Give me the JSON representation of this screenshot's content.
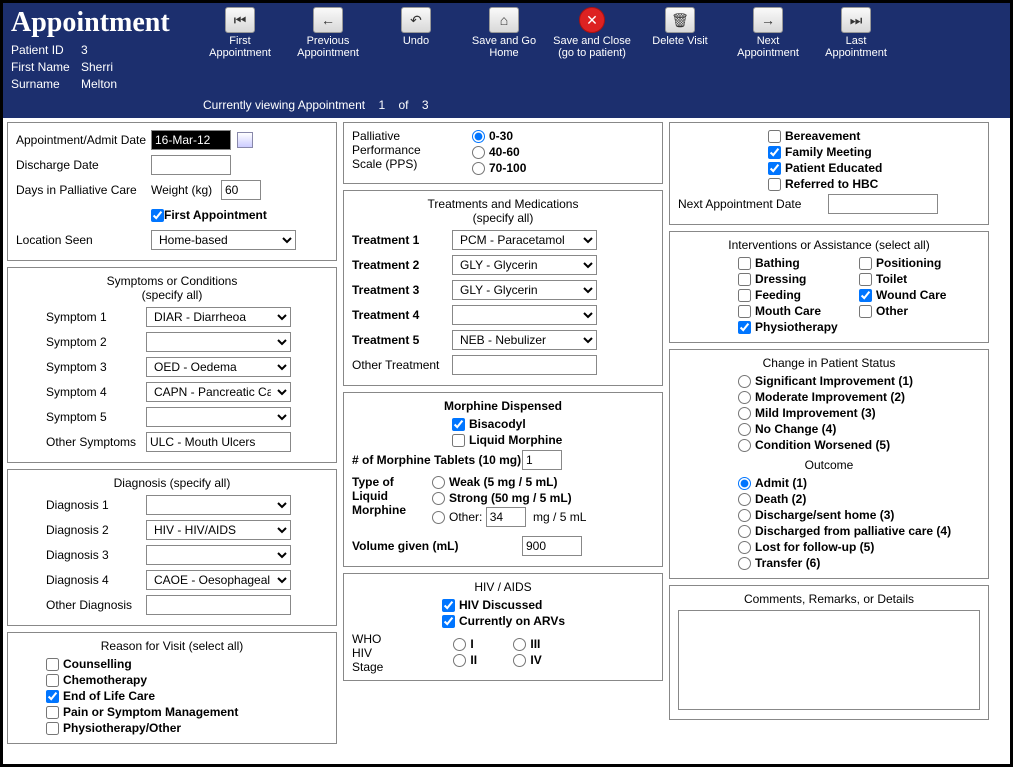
{
  "header": {
    "title": "Appointment",
    "patient_id_label": "Patient ID",
    "patient_id": "3",
    "first_name_label": "First Name",
    "first_name": "Sherri",
    "surname_label": "Surname",
    "surname": "Melton"
  },
  "toolbar": {
    "first": "First Appointment",
    "previous": "Previous Appointment",
    "undo": "Undo",
    "save_home": "Save and Go Home",
    "save_close": "Save and Close (go to patient)",
    "delete": "Delete Visit",
    "next": "Next Appointment",
    "last": "Last Appointment"
  },
  "status": {
    "viewing_label": "Currently viewing Appointment",
    "current": "1",
    "of_label": "of",
    "total": "3"
  },
  "top": {
    "appt_date_label": "Appointment/Admit Date",
    "appt_date": "16-Mar-12",
    "discharge_label": "Discharge Date",
    "discharge": "",
    "days_label": "Days in Palliative Care",
    "weight_label": "Weight (kg)",
    "weight": "60",
    "first_appt_label": "First Appointment",
    "location_label": "Location Seen",
    "location": "Home-based"
  },
  "symptoms": {
    "title": "Symptoms or Conditions",
    "subtitle": "(specify all)",
    "s1_label": "Symptom 1",
    "s1": "DIAR - Diarrheoa",
    "s2_label": "Symptom 2",
    "s2": "",
    "s3_label": "Symptom 3",
    "s3": "OED - Oedema",
    "s4_label": "Symptom 4",
    "s4": "CAPN - Pancreatic Cance",
    "s5_label": "Symptom 5",
    "s5": "",
    "other_label": "Other Symptoms",
    "other": "ULC - Mouth Ulcers"
  },
  "diagnosis": {
    "title": "Diagnosis (specify all)",
    "d1_label": "Diagnosis 1",
    "d1": "",
    "d2_label": "Diagnosis 2",
    "d2": "HIV - HIV/AIDS",
    "d3_label": "Diagnosis 3",
    "d3": "",
    "d4_label": "Diagnosis 4",
    "d4": "CAOE - Oesophageal Car",
    "other_label": "Other Diagnosis",
    "other": ""
  },
  "reason": {
    "title": "Reason for Visit (select all)",
    "counselling": "Counselling",
    "chemo": "Chemotherapy",
    "eol": "End of Life Care",
    "pain": "Pain or Symptom Management",
    "physio": "Physiotherapy/Other"
  },
  "pps": {
    "label1": "Palliative",
    "label2": "Performance",
    "label3": "Scale (PPS)",
    "o1": "0-30",
    "o2": "40-60",
    "o3": "70-100"
  },
  "treatments": {
    "title": "Treatments and Medications",
    "subtitle": "(specify all)",
    "t1_label": "Treatment 1",
    "t1": "PCM - Paracetamol",
    "t2_label": "Treatment 2",
    "t2": "GLY - Glycerin",
    "t3_label": "Treatment 3",
    "t3": "GLY - Glycerin",
    "t4_label": "Treatment 4",
    "t4": "",
    "t5_label": "Treatment 5",
    "t5": "NEB - Nebulizer",
    "other_label": "Other Treatment",
    "other": ""
  },
  "morphine": {
    "title": "Morphine Dispensed",
    "bisacodyl": "Bisacodyl",
    "liquid": "Liquid Morphine",
    "tablets_label": "# of Morphine Tablets (10 mg)",
    "tablets": "1",
    "type_label1": "Type of",
    "type_label2": "Liquid",
    "type_label3": "Morphine",
    "weak": "Weak (5 mg / 5 mL)",
    "strong": "Strong (50 mg / 5 mL)",
    "other_label": "Other:",
    "other_val": "34",
    "other_unit": "mg / 5 mL",
    "volume_label": "Volume given (mL)",
    "volume": "900"
  },
  "hiv": {
    "title": "HIV / AIDS",
    "discussed": "HIV Discussed",
    "arvs": "Currently on ARVs",
    "stage_lbl1": "WHO",
    "stage_lbl2": "HIV",
    "stage_lbl3": "Stage",
    "s1": "I",
    "s2": "II",
    "s3": "III",
    "s4": "IV"
  },
  "right_top": {
    "bereavement": "Bereavement",
    "family": "Family Meeting",
    "educated": "Patient Educated",
    "hbc": "Referred to HBC",
    "next_appt_label": "Next Appointment Date",
    "next_appt": ""
  },
  "interventions": {
    "title": "Interventions or Assistance (select all)",
    "bathing": "Bathing",
    "positioning": "Positioning",
    "dressing": "Dressing",
    "toilet": "Toilet",
    "feeding": "Feeding",
    "wound": "Wound Care",
    "mouth": "Mouth Care",
    "other": "Other",
    "physio": "Physiotherapy"
  },
  "status_change": {
    "title": "Change in Patient Status",
    "o1": "Significant Improvement (1)",
    "o2": "Moderate Improvement (2)",
    "o3": "Mild Improvement (3)",
    "o4": "No Change (4)",
    "o5": "Condition Worsened (5)"
  },
  "outcome": {
    "title": "Outcome",
    "o1": "Admit (1)",
    "o2": "Death (2)",
    "o3": "Discharge/sent home (3)",
    "o4": "Discharged from palliative care (4)",
    "o5": "Lost for follow-up (5)",
    "o6": "Transfer (6)"
  },
  "comments": {
    "title": "Comments, Remarks, or Details",
    "text": ""
  }
}
